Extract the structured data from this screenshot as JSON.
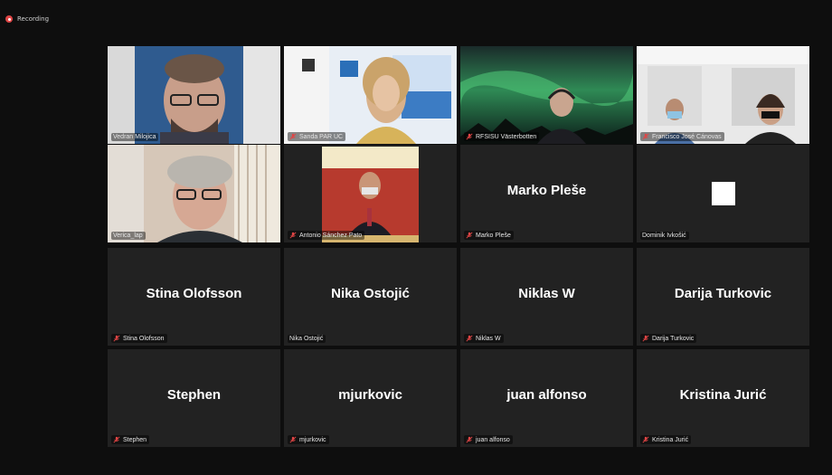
{
  "recording": {
    "label": "Recording"
  },
  "colors": {
    "tile_bg": "#222222",
    "active_border": "#c6d84a",
    "muted_icon": "#e04545"
  },
  "tiles": [
    {
      "name": "Vedran Milojica",
      "muted": false,
      "video": true
    },
    {
      "name": "Sanda PAR UC",
      "muted": true,
      "video": true
    },
    {
      "name": "RFSISU Västerbotten",
      "muted": true,
      "video": true
    },
    {
      "name": "Francisco José Cánovas",
      "muted": true,
      "video": true
    },
    {
      "name": "Verica_lap",
      "muted": false,
      "video": true,
      "active": true
    },
    {
      "name": "Antonio Sánchez Pato",
      "muted": true,
      "video": true
    },
    {
      "name": "Marko Pleše",
      "display": "Marko Pleše",
      "muted": true,
      "video": false
    },
    {
      "name": "Dominik Ivkošić",
      "muted": false,
      "video": false
    },
    {
      "name": "Stina Olofsson",
      "display": "Stina Olofsson",
      "muted": true,
      "video": false
    },
    {
      "name": "Nika Ostojić",
      "display": "Nika Ostojić",
      "muted": false,
      "video": false
    },
    {
      "name": "Niklas W",
      "display": "Niklas W",
      "muted": true,
      "video": false
    },
    {
      "name": "Darija Turkovic",
      "display": "Darija Turkovic",
      "muted": true,
      "video": false
    },
    {
      "name": "Stephen",
      "display": "Stephen",
      "muted": true,
      "video": false
    },
    {
      "name": "mjurkovic",
      "display": "mjurkovic",
      "muted": true,
      "video": false
    },
    {
      "name": "juan alfonso",
      "display": "juan alfonso",
      "muted": true,
      "video": false
    },
    {
      "name": "Kristina Jurić",
      "display": "Kristina Jurić",
      "muted": true,
      "video": false
    }
  ]
}
